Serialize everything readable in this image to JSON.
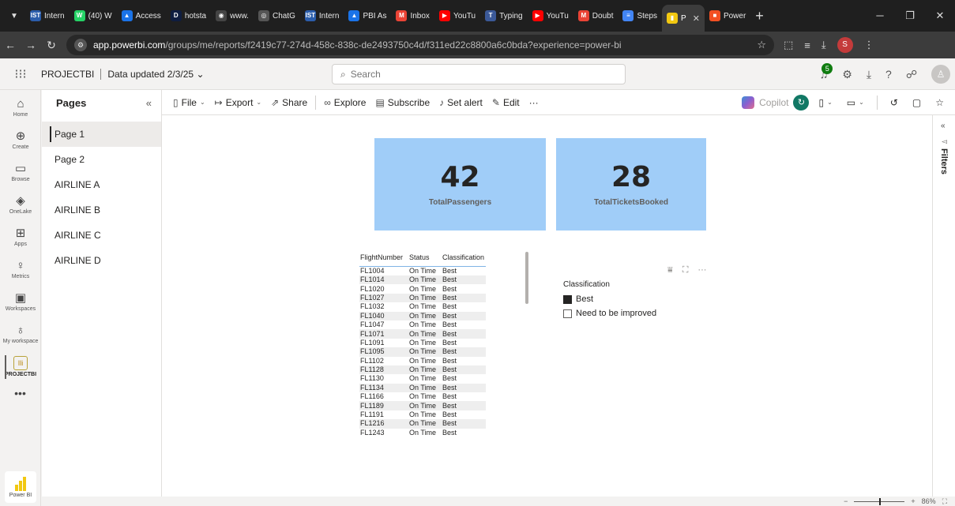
{
  "browser": {
    "tabs": [
      {
        "label": "Intern",
        "fav_color": "#2b5dab",
        "fav_glyph": "IST"
      },
      {
        "label": "(40) W",
        "fav_color": "#25d366",
        "fav_glyph": "W"
      },
      {
        "label": "Access",
        "fav_color": "#1a73e8",
        "fav_glyph": "▲"
      },
      {
        "label": "hotsta",
        "fav_color": "#0f1d40",
        "fav_glyph": "D"
      },
      {
        "label": "www.",
        "fav_color": "#444444",
        "fav_glyph": "◉"
      },
      {
        "label": "ChatG",
        "fav_color": "#555555",
        "fav_glyph": "◎"
      },
      {
        "label": "Intern",
        "fav_color": "#2b5dab",
        "fav_glyph": "IST"
      },
      {
        "label": "PBI As",
        "fav_color": "#1a73e8",
        "fav_glyph": "▲"
      },
      {
        "label": "Inbox",
        "fav_color": "#ea4335",
        "fav_glyph": "M"
      },
      {
        "label": "YouTu",
        "fav_color": "#ff0000",
        "fav_glyph": "▶"
      },
      {
        "label": "Typing",
        "fav_color": "#3b5998",
        "fav_glyph": "T"
      },
      {
        "label": "YouTu",
        "fav_color": "#ff0000",
        "fav_glyph": "▶"
      },
      {
        "label": "Doubt",
        "fav_color": "#ea4335",
        "fav_glyph": "M"
      },
      {
        "label": "Steps",
        "fav_color": "#4285f4",
        "fav_glyph": "≡"
      }
    ],
    "active_tab": {
      "label": "P",
      "fav_color": "#f2c811",
      "fav_glyph": "▮"
    },
    "after_tab": {
      "label": "Power",
      "fav_color": "#f25022",
      "fav_glyph": "■"
    },
    "url_host": "app.powerbi.com",
    "url_path": "/groups/me/reports/f2419c77-274d-458c-838c-de2493750c4d/f311ed22c8800a6c0bda?experience=power-bi",
    "profile_initial": "S"
  },
  "header": {
    "workspace": "PROJECTBI",
    "data_updated": "Data updated 2/3/25",
    "search_placeholder": "Search",
    "notification_count": "5"
  },
  "navrail": {
    "items": [
      {
        "label": "Home",
        "icon": "⌂"
      },
      {
        "label": "Create",
        "icon": "⊕"
      },
      {
        "label": "Browse",
        "icon": "▭"
      },
      {
        "label": "OneLake",
        "icon": "◈"
      },
      {
        "label": "Apps",
        "icon": "⊞"
      },
      {
        "label": "Metrics",
        "icon": "♀"
      },
      {
        "label": "Workspaces",
        "icon": "▣"
      },
      {
        "label": "My workspace",
        "icon": "♁"
      }
    ],
    "project": {
      "label": "PROJECTBI",
      "icon": "Ili"
    },
    "more": "•••",
    "product": "Power BI"
  },
  "pages": {
    "title": "Pages",
    "items": [
      "Page 1",
      "Page 2",
      "AIRLINE A",
      "AIRLINE B",
      "AIRLINE C",
      "AIRLINE D"
    ],
    "active_index": 0
  },
  "toolbar": {
    "file": "File",
    "export": "Export",
    "share": "Share",
    "explore": "Explore",
    "subscribe": "Subscribe",
    "set_alert": "Set alert",
    "edit": "Edit",
    "more": "···",
    "copilot": "Copilot"
  },
  "cards": [
    {
      "value": "42",
      "label": "TotalPassengers"
    },
    {
      "value": "28",
      "label": "TotalTicketsBooked"
    }
  ],
  "table": {
    "columns": [
      "FlightNumber",
      "Status",
      "Classification"
    ],
    "rows": [
      [
        "FL1004",
        "On Time",
        "Best"
      ],
      [
        "FL1014",
        "On Time",
        "Best"
      ],
      [
        "FL1020",
        "On Time",
        "Best"
      ],
      [
        "FL1027",
        "On Time",
        "Best"
      ],
      [
        "FL1032",
        "On Time",
        "Best"
      ],
      [
        "FL1040",
        "On Time",
        "Best"
      ],
      [
        "FL1047",
        "On Time",
        "Best"
      ],
      [
        "FL1071",
        "On Time",
        "Best"
      ],
      [
        "FL1091",
        "On Time",
        "Best"
      ],
      [
        "FL1095",
        "On Time",
        "Best"
      ],
      [
        "FL1102",
        "On Time",
        "Best"
      ],
      [
        "FL1128",
        "On Time",
        "Best"
      ],
      [
        "FL1130",
        "On Time",
        "Best"
      ],
      [
        "FL1134",
        "On Time",
        "Best"
      ],
      [
        "FL1166",
        "On Time",
        "Best"
      ],
      [
        "FL1189",
        "On Time",
        "Best"
      ],
      [
        "FL1191",
        "On Time",
        "Best"
      ],
      [
        "FL1216",
        "On Time",
        "Best"
      ],
      [
        "FL1243",
        "On Time",
        "Best"
      ]
    ]
  },
  "slicer": {
    "title": "Classification",
    "options": [
      {
        "label": "Best",
        "checked": true
      },
      {
        "label": "Need to be improved",
        "checked": false
      }
    ]
  },
  "filters": {
    "label": "Filters"
  },
  "status": {
    "zoom": "86%"
  },
  "colors": {
    "card_bg": "#a0cdf8",
    "accent": "#117865",
    "brand": "#f2c811"
  }
}
